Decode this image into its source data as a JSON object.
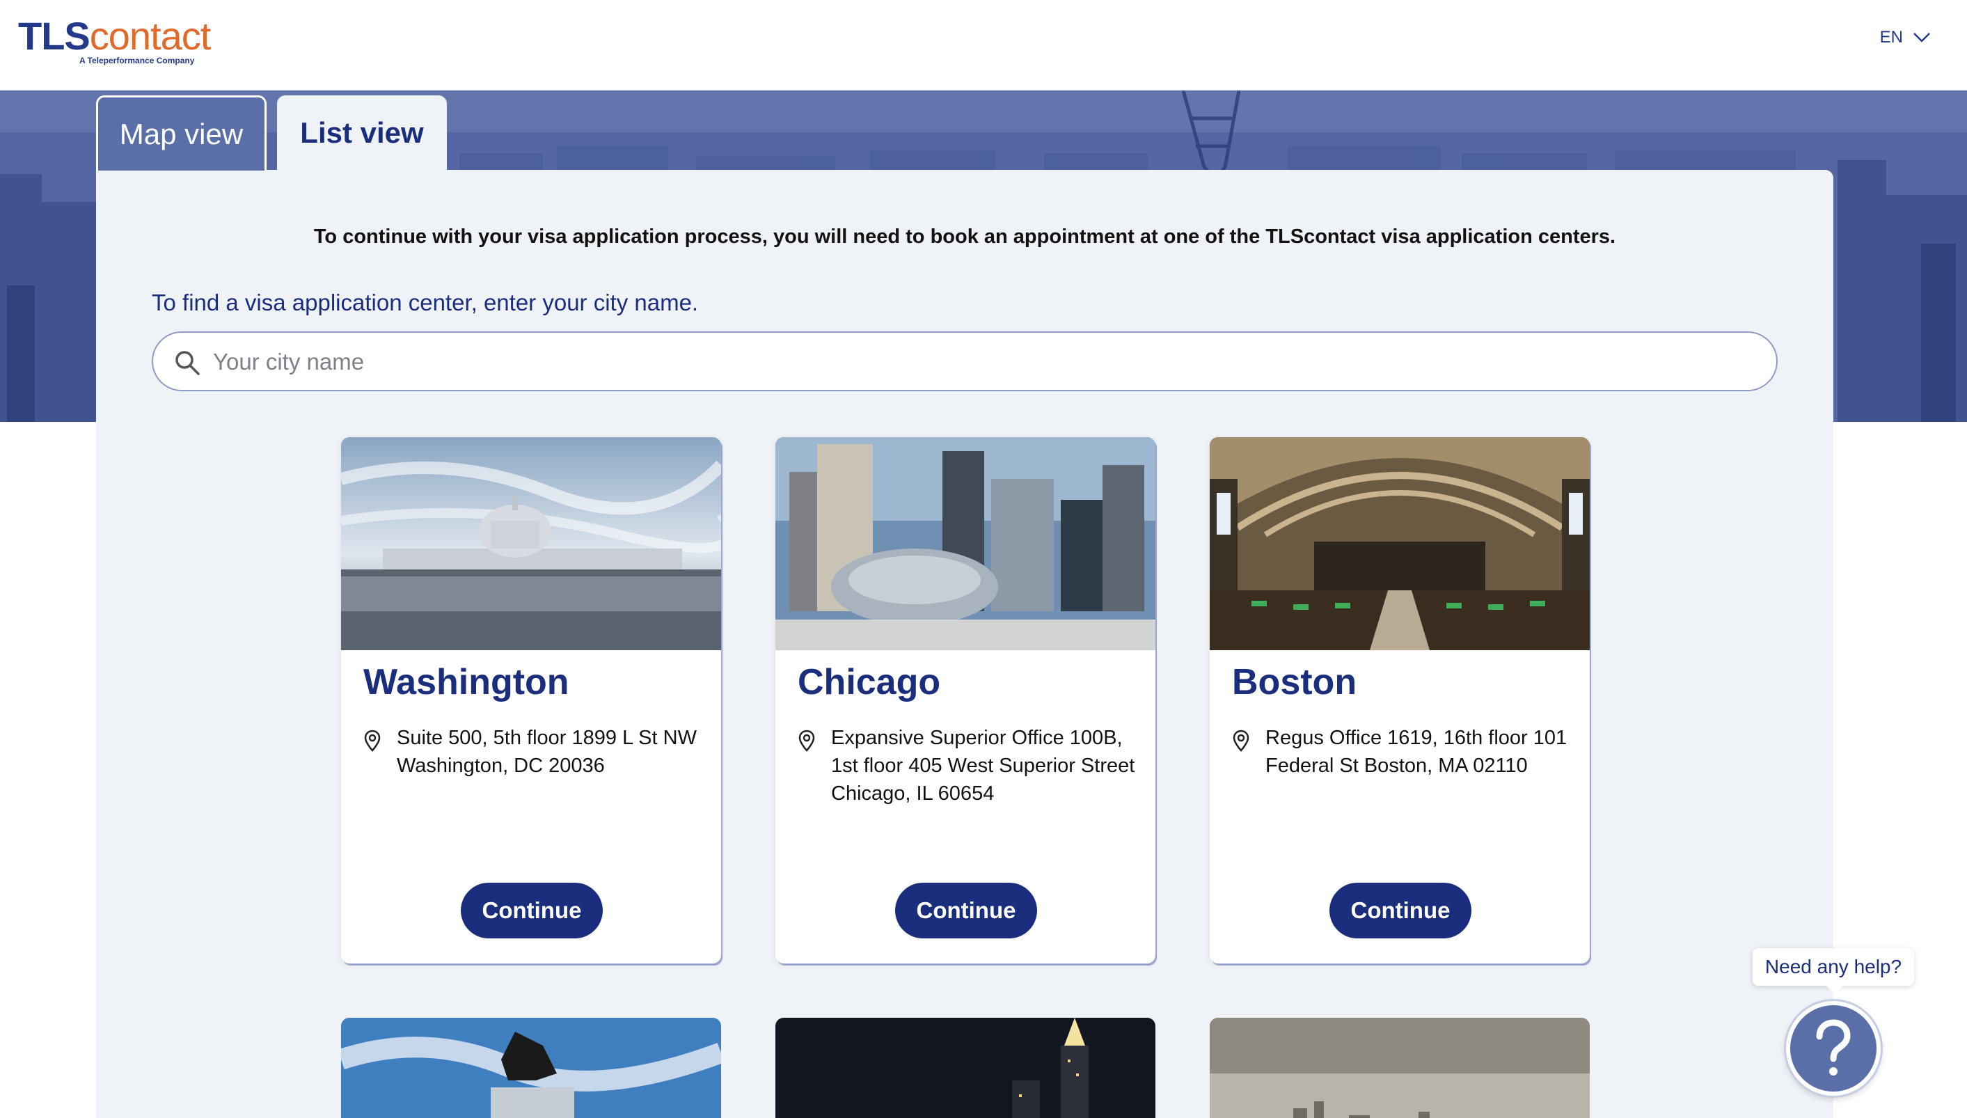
{
  "header": {
    "logo_primary": "TLS",
    "logo_secondary": "contact",
    "logo_tagline": "A Teleperformance Company",
    "language": "EN"
  },
  "tabs": [
    {
      "label": "Map view",
      "active": false
    },
    {
      "label": "List view",
      "active": true
    }
  ],
  "main": {
    "intro": "To continue with your visa application process, you will need to book an appointment at one of the TLScontact visa application centers.",
    "find_label": "To find a visa application center, enter your city name.",
    "search_placeholder": "Your city name"
  },
  "cards": [
    {
      "city": "Washington",
      "address": "Suite 500, 5th floor 1899 L St NW Washington, DC 20036",
      "button": "Continue"
    },
    {
      "city": "Chicago",
      "address": "Expansive Superior Office 100B, 1st floor 405 West Superior Street Chicago, IL 60654",
      "button": "Continue"
    },
    {
      "city": "Boston",
      "address": "Regus Office 1619, 16th floor 101 Federal St Boston, MA 02110",
      "button": "Continue"
    }
  ],
  "help": {
    "bubble_text": "Need any help?"
  },
  "colors": {
    "brand_primary": "#1b2d7d",
    "brand_accent": "#e0692c",
    "panel_bg": "#eff2f6",
    "banner_bg": "#566aa6"
  }
}
